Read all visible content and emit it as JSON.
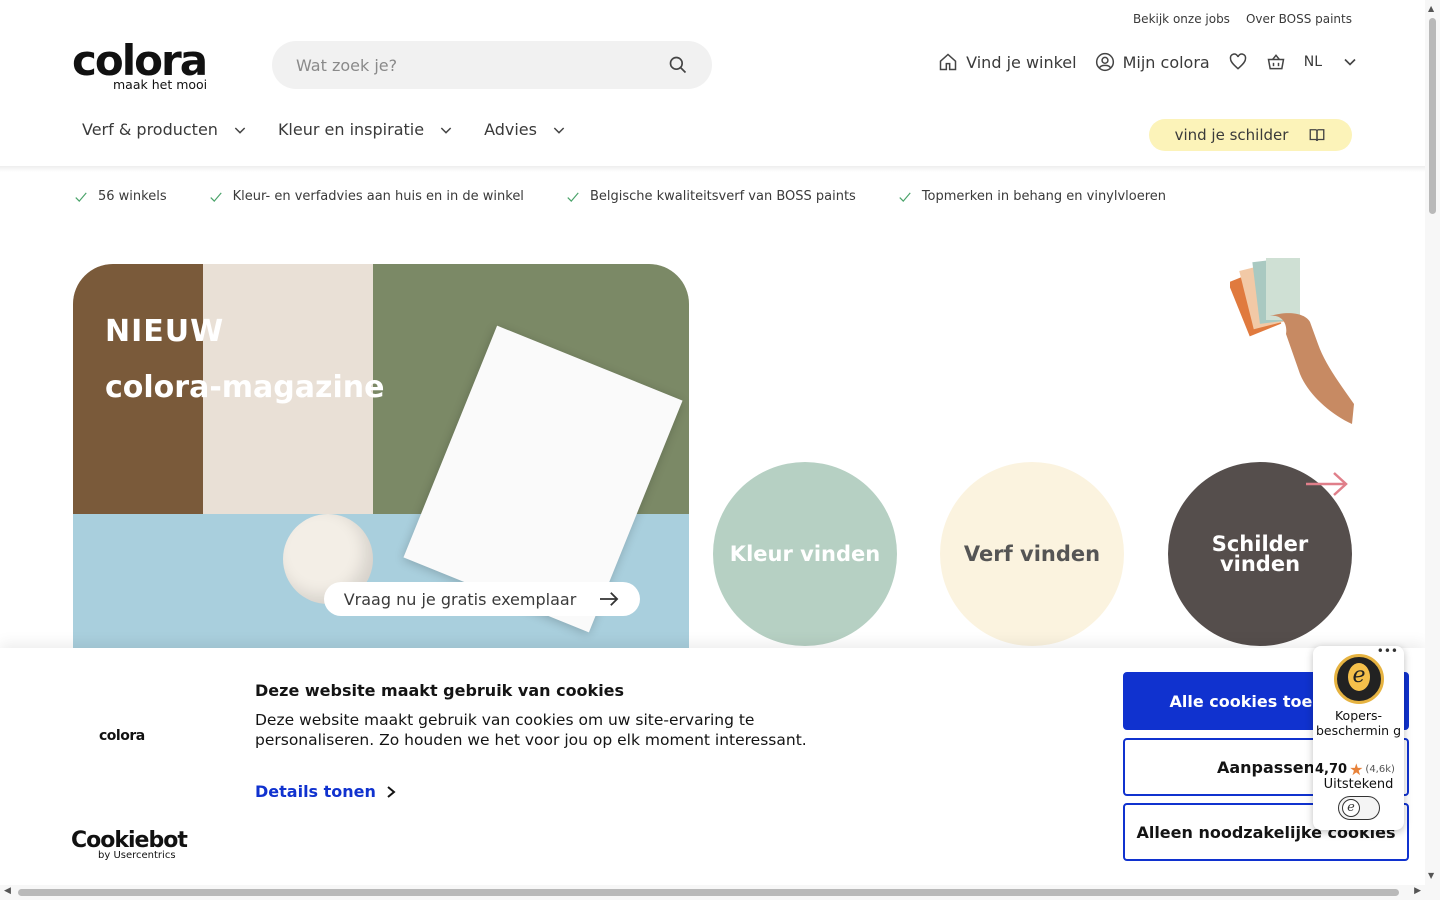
{
  "topbar": {
    "jobs": "Bekijk onze jobs",
    "about": "Over BOSS paints"
  },
  "logo": {
    "word": "colora",
    "tagline": "maak het mooi"
  },
  "search": {
    "placeholder": "Wat zoek je?"
  },
  "header": {
    "store": "Vind je winkel",
    "account": "Mijn colora",
    "language": "NL"
  },
  "nav": [
    {
      "label": "Verf & producten"
    },
    {
      "label": "Kleur en inspiratie"
    },
    {
      "label": "Advies"
    }
  ],
  "painter_button": "vind je schilder",
  "usps": [
    "56 winkels",
    "Kleur- en verfadvies aan huis en in de winkel",
    "Belgische kwaliteitsverf van BOSS paints",
    "Topmerken in behang en vinylvloeren"
  ],
  "hero": {
    "line1": "NIEUW",
    "line2": "colora-magazine",
    "cta": "Vraag nu je gratis exemplaar"
  },
  "circles": [
    "Kleur vinden",
    "Verf vinden",
    "Schilder vinden"
  ],
  "cookie": {
    "logo": "colora",
    "title": "Deze website maakt gebruik van cookies",
    "text": "Deze website maakt gebruik van cookies om uw site-ervaring te personaliseren. Zo houden we het voor jou op elk moment interessant.",
    "details": "Details tonen",
    "brand": "Cookiebot",
    "brand_sub": "by Usercentrics",
    "accept_all": "Alle cookies toestaan",
    "customize": "Aanpassen",
    "necessary_only": "Alleen noodzakelijke cookies"
  },
  "trusted": {
    "label": "Kopers-beschermin g",
    "rating": "4,70",
    "count": "(4,6k)",
    "verdict": "Uitstekend"
  },
  "colors": {
    "accent": "#1032cf",
    "circle_green": "#b6d0c3",
    "circle_cream": "#fbf3df",
    "circle_dark": "#554e4c",
    "painter_yellow": "#fcf3b9"
  }
}
